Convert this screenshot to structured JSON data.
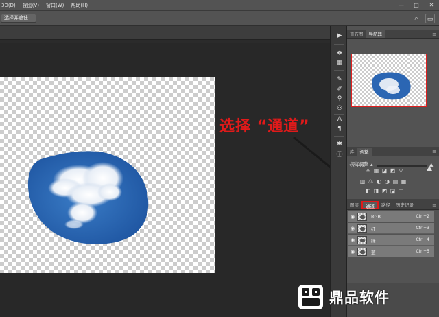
{
  "menubar": {
    "items": [
      "3D(D)",
      "视图(V)",
      "窗口(W)",
      "帮助(H)"
    ],
    "window_controls": [
      "—",
      "□",
      "✕"
    ]
  },
  "options_bar": {
    "select_and_mask": "选择并遮住...",
    "search_icon": "search-icon",
    "workspace_icon": "workspace-icon"
  },
  "tools": [
    "play-icon",
    "3d-cube-icon",
    "grid-icon",
    "brush-icon",
    "brush-settings-icon",
    "clone-icon",
    "sliders-icon",
    "stamp-icon",
    "character-icon",
    "paragraph-icon",
    "fx-icon",
    "info-icon"
  ],
  "navigator": {
    "tabs": [
      "直方图",
      "导航器"
    ],
    "active_tab": "导航器",
    "zoom": "33.33%"
  },
  "adjustments": {
    "tabs": [
      "库",
      "调整"
    ],
    "active_tab": "调整",
    "label": "添加调整",
    "row1": [
      "☀",
      "▦",
      "◪",
      "◩",
      "▽"
    ],
    "row2": [
      "▥",
      "⚖",
      "◐",
      "◑",
      "▤",
      "▦"
    ],
    "row3": [
      "◧",
      "◨",
      "◩",
      "◪",
      "◫"
    ]
  },
  "channels_panel": {
    "tabs": [
      "图层",
      "通道",
      "路径",
      "历史记录"
    ],
    "active_tab": "通道",
    "channels": [
      {
        "name": "RGB",
        "shortcut": "Ctrl+2"
      },
      {
        "name": "红",
        "shortcut": "Ctrl+3"
      },
      {
        "name": "绿",
        "shortcut": "Ctrl+4"
      },
      {
        "name": "蓝",
        "shortcut": "Ctrl+5"
      }
    ]
  },
  "annotation": {
    "text": "选择 “通道”",
    "color": "#e01a1a"
  },
  "watermark": {
    "text": "鼎品软件"
  },
  "colors": {
    "sky_blue": "#2b66b3",
    "accent_red": "#e01a1a",
    "panel_gray": "#535353"
  }
}
